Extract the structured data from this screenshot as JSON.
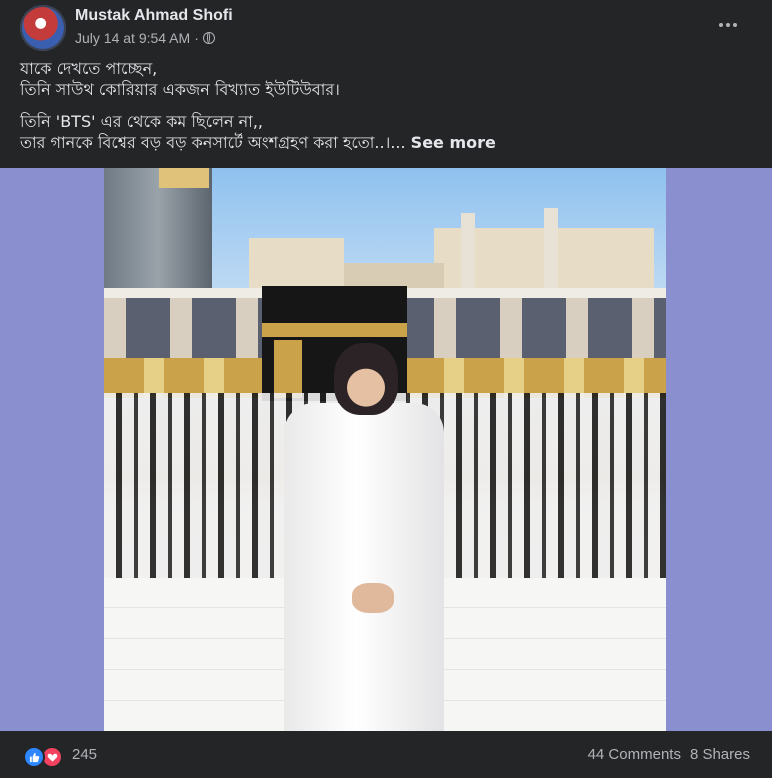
{
  "post": {
    "author": "Mustak Ahmad Shofi",
    "timestamp": "July 14 at 9:54 AM",
    "separator": "·",
    "privacy_icon": "globe-icon",
    "more_icon": "more-options-icon",
    "text_lines": [
      "যাকে দেখতে পাচ্ছেন,",
      "তিনি সাউথ কোরিয়ার একজন বিখ্যাত ইউটিউবার।",
      "তিনি 'BTS' এর থেকে কম ছিলেন না,,",
      "তার গানকে বিশ্বের বড় বড় কনসার্টে অংশগ্রহণ করা হতো..।..."
    ],
    "see_more": "See more"
  },
  "footer": {
    "reaction_icons": [
      "like-icon",
      "love-icon"
    ],
    "reaction_count": "245",
    "comments": "44 Comments",
    "shares": "8 Shares"
  },
  "colors": {
    "background": "#242526",
    "media_background": "#8a8fcf",
    "like": "#2d88ff",
    "love": "#f3425f",
    "secondary_text": "#b0b3b8"
  }
}
